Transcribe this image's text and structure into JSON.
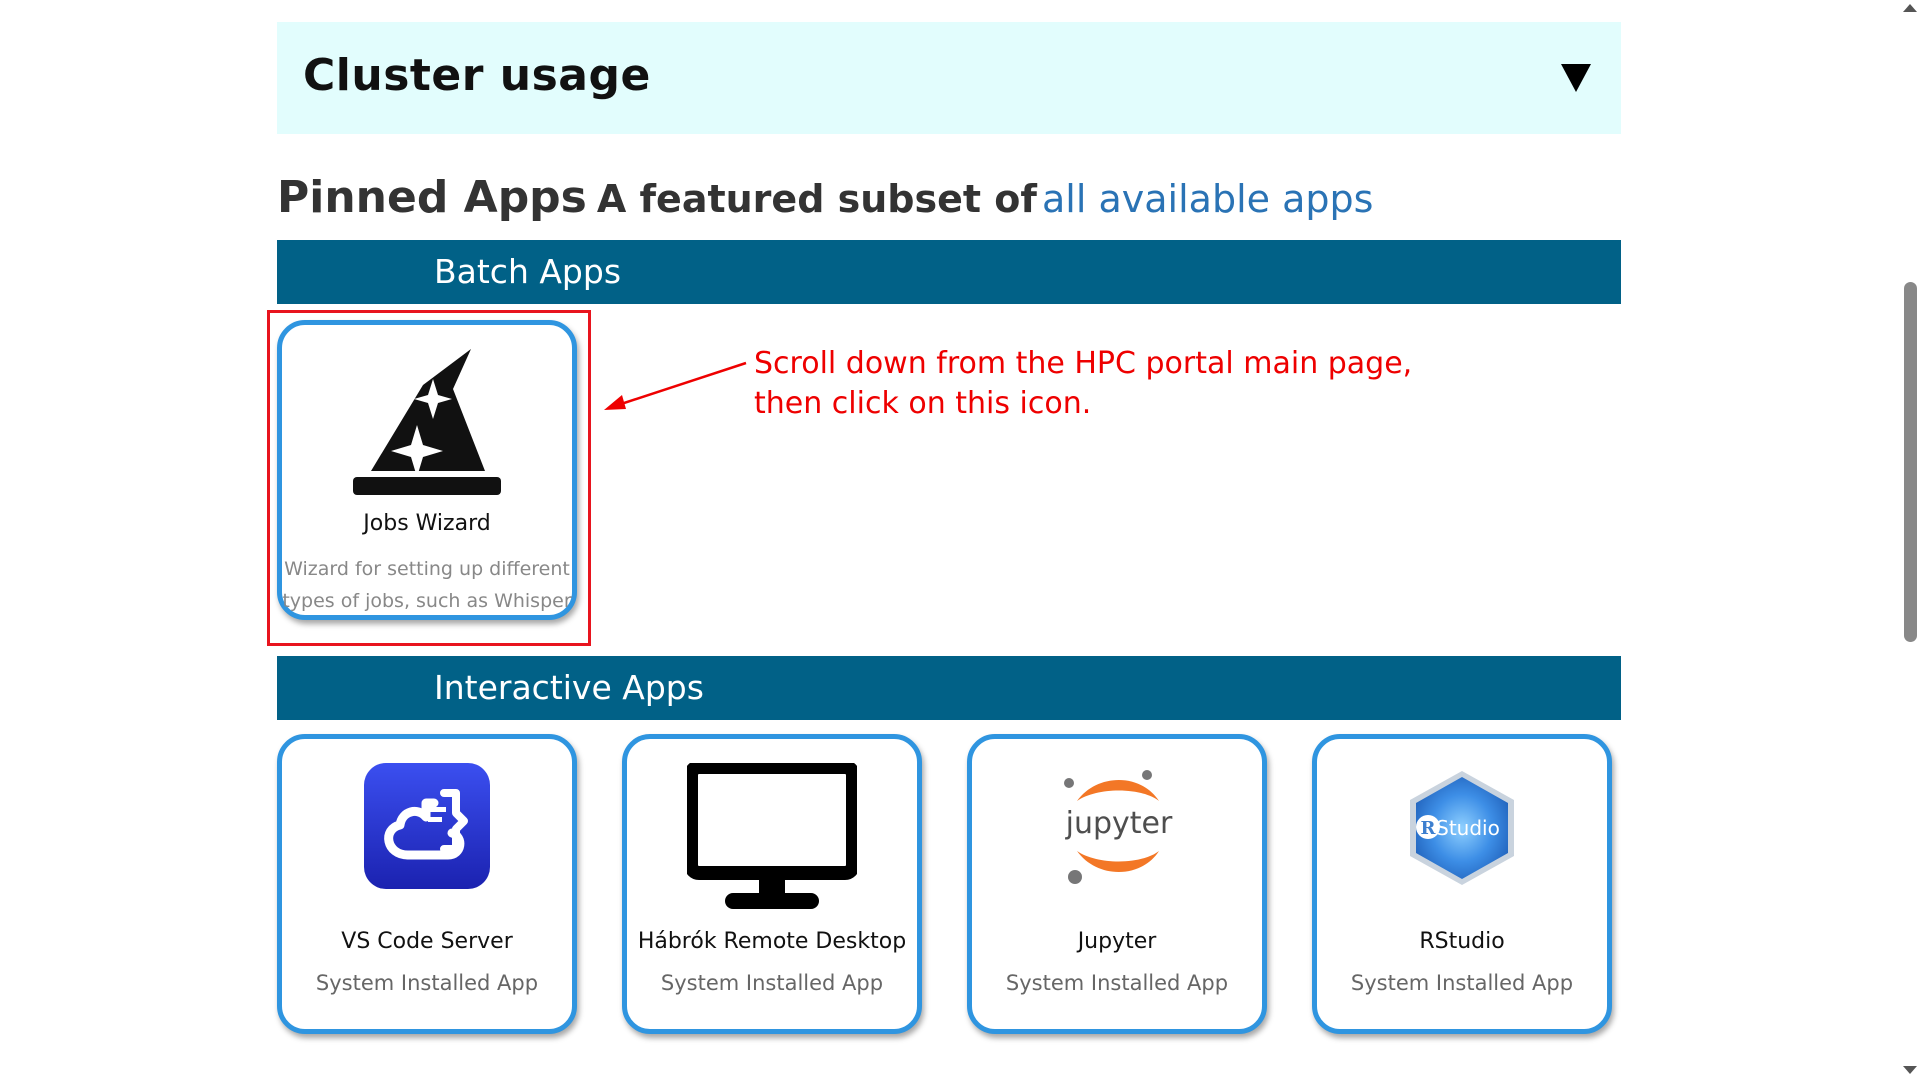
{
  "cluster": {
    "title": "Cluster usage"
  },
  "pinned": {
    "title": "Pinned Apps",
    "subtitle": "A featured subset of",
    "link": "all available apps"
  },
  "sections": {
    "batch": "Batch Apps",
    "interactive": "Interactive Apps"
  },
  "batch_apps": [
    {
      "name": "Jobs Wizard",
      "desc_line1": "Wizard for setting up different",
      "desc_line2": "types of jobs, such as Whisper",
      "icon": "wizard-hat-icon"
    }
  ],
  "interactive_apps": [
    {
      "name": "VS Code Server",
      "desc": "System Installed App",
      "icon": "vscode-server-icon"
    },
    {
      "name": "Hábrók Remote Desktop",
      "desc": "System Installed App",
      "icon": "monitor-icon"
    },
    {
      "name": "Jupyter",
      "desc": "System Installed App",
      "icon": "jupyter-icon",
      "logo_text": "jupyter"
    },
    {
      "name": "RStudio",
      "desc": "System Installed App",
      "icon": "rstudio-icon",
      "logo_r": "R",
      "logo_text": "Studio"
    }
  ],
  "annotation": {
    "line1": "Scroll down from the HPC portal main page,",
    "line2": "then click on this icon."
  },
  "colors": {
    "cluster_bg": "#e2fdfd",
    "section_bar": "#016187",
    "card_border": "#2f95e0",
    "link": "#2a73b5",
    "annotation": "#ee0000"
  }
}
